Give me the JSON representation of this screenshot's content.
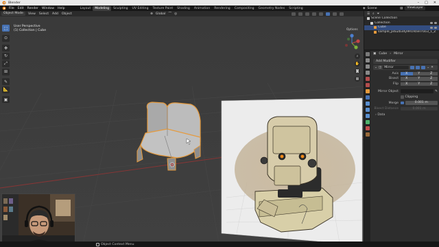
{
  "app": {
    "title": "Blender"
  },
  "menubar": {
    "items": [
      "File",
      "Edit",
      "Render",
      "Window",
      "Help"
    ],
    "workspaces": [
      "Layout",
      "Modeling",
      "Sculpting",
      "UV Editing",
      "Texture Paint",
      "Shading",
      "Animation",
      "Rendering",
      "Compositing",
      "Geometry Nodes",
      "Scripting"
    ],
    "active_workspace": "Modeling",
    "scene": "Scene",
    "view_layer": "ViewLayer"
  },
  "viewport": {
    "mode": "Object Mode",
    "menu": [
      "View",
      "Select",
      "Add",
      "Object"
    ],
    "orientation": "Global",
    "options": "Options",
    "info_line1": "User Perspective",
    "info_line2": "(1) Collection | Cube"
  },
  "outliner": {
    "rows": [
      {
        "label": "Scene Collection",
        "icon_color": "#cfcfcf",
        "selected": false,
        "indent": 0
      },
      {
        "label": "Collection",
        "icon_color": "#cfcfcf",
        "selected": false,
        "indent": 1
      },
      {
        "label": "Cube",
        "icon_color": "#e69a3c",
        "selected": true,
        "indent": 2
      },
      {
        "label": "sample_pdu2b34y9R19ziel7Uo3_1_Z",
        "icon_color": "#e69a3c",
        "selected": false,
        "indent": 2
      }
    ]
  },
  "properties": {
    "object_name": "Cube",
    "modifier_breadcrumb": "Mirror",
    "add_modifier": "Add Modifier",
    "modifier_name": "Mirror",
    "axis_label": "Axis",
    "bisect_label": "Bisect",
    "flip_label": "Flip",
    "axes": [
      "X",
      "Y",
      "Z"
    ],
    "mirror_object_label": "Mirror Object",
    "clipping_label": "Clipping",
    "merge_label": "Merge",
    "merge_value": "0.001 m",
    "bisect_distance_label": "Bisect Distance",
    "bisect_distance_value": "0.001 m",
    "data_label": "Data"
  },
  "status": {
    "text": "Object Context Menu"
  },
  "colors": {
    "accent": "#4772b3",
    "selection_outline": "#e69a3c",
    "grid_x_axis": "#a03a3a"
  }
}
